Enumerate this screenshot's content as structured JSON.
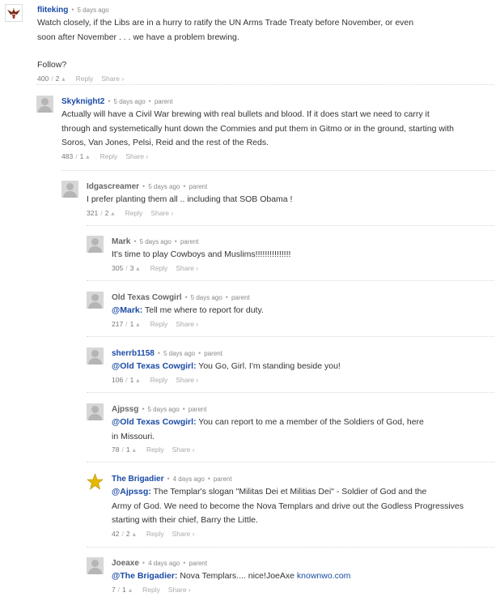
{
  "comments": [
    {
      "author": "fliteking",
      "time": "5 days ago",
      "parent": "",
      "lines": [
        "Watch closely, if the Libs are in a hurry to ratify the  UN Arms Trade Treaty before November, or even",
        "soon after November . . . we have a problem brewing.",
        "",
        "Follow?"
      ],
      "votes": "400",
      "likes": "2",
      "reply": "Reply",
      "share": "Share ›"
    },
    {
      "author": "Skyknight2",
      "time": "5 days ago",
      "parent": "parent",
      "lines": [
        "Actually will have a Civil War brewing with real bullets and blood. If it does start we need to carry it",
        "through and systemetically hunt down the Commies and put them in Gitmo or in the ground, starting with",
        "Soros, Van Jones, Pelsi, Reid and the rest of the Reds."
      ],
      "votes": "483",
      "likes": "1",
      "reply": "Reply",
      "share": "Share ›"
    },
    {
      "author": "Idgascreamer",
      "time": "5 days ago",
      "parent": "parent",
      "lines": [
        "I prefer planting them all .. including  that SOB Obama !"
      ],
      "votes": "321",
      "likes": "2",
      "reply": "Reply",
      "share": "Share ›"
    },
    {
      "author": "Mark",
      "time": "5 days ago",
      "parent": "parent",
      "lines": [
        "It's time to play Cowboys and Muslims!!!!!!!!!!!!!!!"
      ],
      "votes": "305",
      "likes": "3",
      "reply": "Reply",
      "share": "Share ›"
    },
    {
      "author": "Old Texas Cowgirl",
      "time": "5 days ago",
      "parent": "parent",
      "mention": "@Mark:",
      "lines": [
        " Tell me where to report for duty."
      ],
      "votes": "217",
      "likes": "1",
      "reply": "Reply",
      "share": "Share ›"
    },
    {
      "author": "sherrb1158",
      "time": "5 days ago",
      "parent": "parent",
      "mention": "@Old Texas Cowgirl:",
      "lines": [
        " You Go, Girl.  I'm standing beside you!"
      ],
      "votes": "106",
      "likes": "1",
      "reply": "Reply",
      "share": "Share ›"
    },
    {
      "author": "Ajpssg",
      "time": "5 days ago",
      "parent": "parent",
      "mention": "@Old Texas Cowgirl:",
      "lines": [
        " You can report to me a member of the Soldiers of God, here",
        "in Missouri."
      ],
      "votes": "78",
      "likes": "1",
      "reply": "Reply",
      "share": "Share ›"
    },
    {
      "author": "The Brigadier",
      "time": "4 days ago",
      "parent": "parent",
      "mention": "@Ajpssg:",
      "lines": [
        " The Templar's slogan \"Militas Dei et Militias Dei\" - Soldier of God and the",
        "Army of God. We need to become the Nova Templars and drive out the Godless Progressives",
        "starting with their chief, Barry the Little."
      ],
      "votes": "42",
      "likes": "2",
      "reply": "Reply",
      "share": "Share ›"
    },
    {
      "author": "Joeaxe",
      "time": "4 days ago",
      "parent": "parent",
      "mention": "@The Brigadier:",
      "lines": [
        " Nova Templars.... nice!JoeAxe "
      ],
      "link": "knownwo.com",
      "votes": "7",
      "likes": "1",
      "reply": "Reply",
      "share": "Share ›"
    }
  ]
}
